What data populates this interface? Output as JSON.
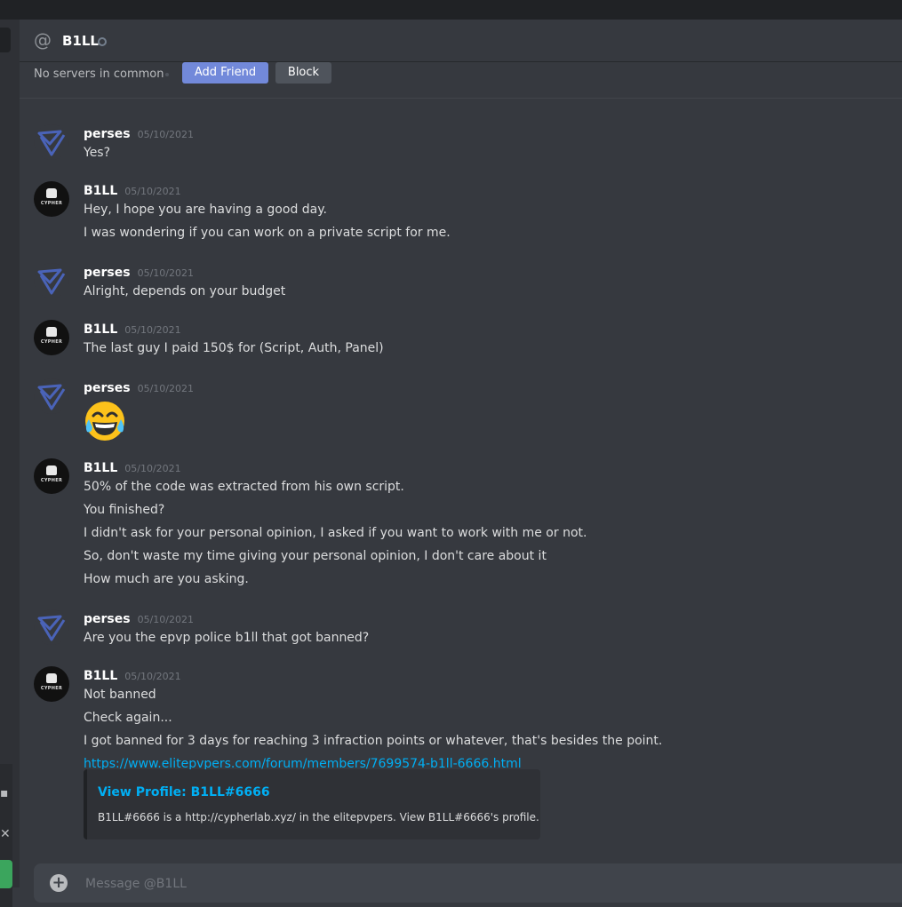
{
  "header": {
    "title": "B1LL"
  },
  "infobar": {
    "common": "No servers in common",
    "add_label": "Add Friend",
    "block_label": "Block"
  },
  "messages": [
    {
      "author": "perses",
      "time": "05/10/2021",
      "lines": [
        "Yes?"
      ]
    },
    {
      "author": "B1LL",
      "time": "05/10/2021",
      "lines": [
        "Hey, I hope you are having a good day.",
        "I was wondering if you can work on a private script for me."
      ]
    },
    {
      "author": "perses",
      "time": "05/10/2021",
      "lines": [
        "Alright, depends on your budget"
      ]
    },
    {
      "author": "B1LL",
      "time": "05/10/2021",
      "lines": [
        "The last guy I paid 150$ for (Script, Auth, Panel)"
      ]
    },
    {
      "author": "perses",
      "time": "05/10/2021",
      "emoji": "joy-emoji"
    },
    {
      "author": "B1LL",
      "time": "05/10/2021",
      "lines": [
        "50% of the code was extracted from his own script.",
        "You finished?",
        "I didn't ask for your personal opinion, I asked if you want to work with me or not.",
        "So, don't waste my time giving your personal opinion, I don't care about it",
        "How much are you asking."
      ]
    },
    {
      "author": "perses",
      "time": "05/10/2021",
      "lines": [
        "Are you the epvp police b1ll that got banned?"
      ]
    },
    {
      "author": "B1LL",
      "time": "05/10/2021",
      "lines": [
        "Not banned",
        "Check again...",
        "I got banned for 3 days for reaching 3 infraction points or whatever, that's besides the point."
      ],
      "link": "https://www.elitepvpers.com/forum/members/7699574-b1ll-6666.html"
    }
  ],
  "embed": {
    "title": "View Profile: B1LL#6666",
    "description": "B1LL#6666 is a http://cypherlab.xyz/ in the elitepvpers. View B1LL#6666's profile."
  },
  "avatar": {
    "bill_label": "CYPHER"
  },
  "composer": {
    "placeholder": "Message @B1LL"
  },
  "colors": {
    "accent": "#7289da",
    "link": "#00aff4",
    "bg": "#36393f"
  }
}
